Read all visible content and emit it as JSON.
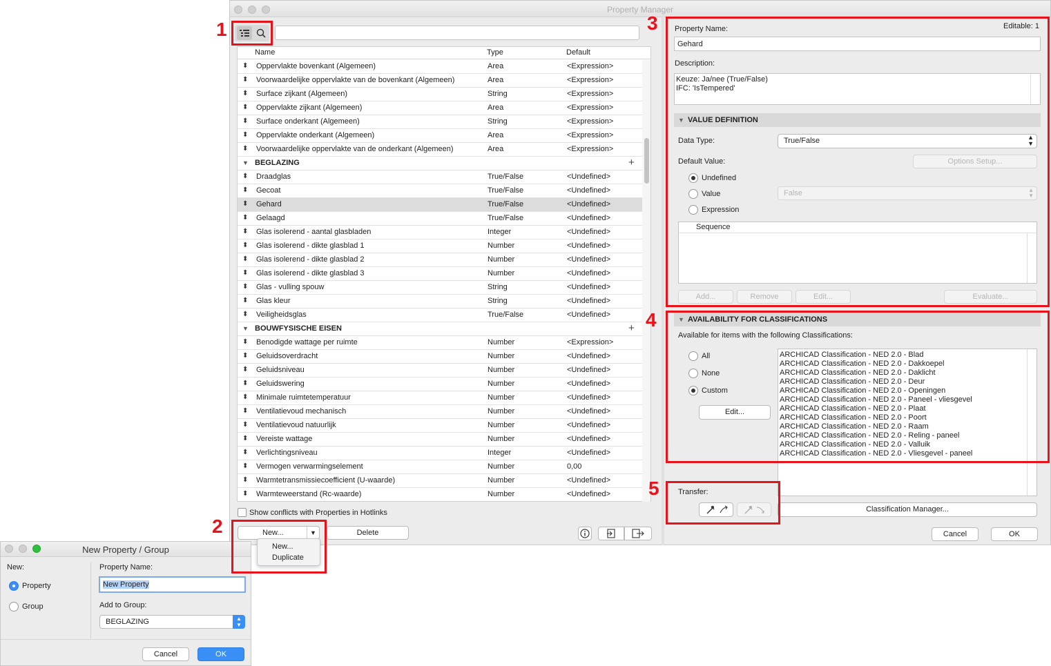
{
  "window": {
    "title": "Property Manager"
  },
  "toolbar": {
    "list_icon": "list-view-icon",
    "search_icon": "search-icon",
    "search_value": ""
  },
  "list": {
    "col_name": "Name",
    "col_type": "Type",
    "col_default": "Default",
    "rows": [
      {
        "kind": "item",
        "name": "Oppervlakte bovenkant (Algemeen)",
        "type": "Area",
        "def": "<Expression>"
      },
      {
        "kind": "item",
        "name": "Voorwaardelijke oppervlakte van de bovenkant (Algemeen)",
        "type": "Area",
        "def": "<Expression>"
      },
      {
        "kind": "item",
        "name": "Surface zijkant (Algemeen)",
        "type": "String",
        "def": "<Expression>"
      },
      {
        "kind": "item",
        "name": "Oppervlakte zijkant (Algemeen)",
        "type": "Area",
        "def": "<Expression>"
      },
      {
        "kind": "item",
        "name": "Surface onderkant (Algemeen)",
        "type": "String",
        "def": "<Expression>"
      },
      {
        "kind": "item",
        "name": "Oppervlakte onderkant (Algemeen)",
        "type": "Area",
        "def": "<Expression>"
      },
      {
        "kind": "item",
        "name": "Voorwaardelijke oppervlakte van de onderkant (Algemeen)",
        "type": "Area",
        "def": "<Expression>"
      },
      {
        "kind": "group",
        "name": "BEGLAZING"
      },
      {
        "kind": "item",
        "name": "Draadglas",
        "type": "True/False",
        "def": "<Undefined>"
      },
      {
        "kind": "item",
        "name": "Gecoat",
        "type": "True/False",
        "def": "<Undefined>"
      },
      {
        "kind": "item",
        "name": "Gehard",
        "type": "True/False",
        "def": "<Undefined>",
        "selected": true
      },
      {
        "kind": "item",
        "name": "Gelaagd",
        "type": "True/False",
        "def": "<Undefined>"
      },
      {
        "kind": "item",
        "name": "Glas isolerend - aantal glasbladen",
        "type": "Integer",
        "def": "<Undefined>"
      },
      {
        "kind": "item",
        "name": "Glas isolerend - dikte glasblad 1",
        "type": "Number",
        "def": "<Undefined>"
      },
      {
        "kind": "item",
        "name": "Glas isolerend - dikte glasblad 2",
        "type": "Number",
        "def": "<Undefined>"
      },
      {
        "kind": "item",
        "name": "Glas isolerend - dikte glasblad 3",
        "type": "Number",
        "def": "<Undefined>"
      },
      {
        "kind": "item",
        "name": "Glas  - vulling spouw",
        "type": "String",
        "def": "<Undefined>"
      },
      {
        "kind": "item",
        "name": "Glas kleur",
        "type": "String",
        "def": "<Undefined>"
      },
      {
        "kind": "item",
        "name": "Veiligheidsglas",
        "type": "True/False",
        "def": "<Undefined>"
      },
      {
        "kind": "group",
        "name": "BOUWFYSISCHE EISEN"
      },
      {
        "kind": "item",
        "name": "Benodigde wattage per ruimte",
        "type": "Number",
        "def": "<Expression>"
      },
      {
        "kind": "item",
        "name": "Geluidsoverdracht",
        "type": "Number",
        "def": "<Undefined>"
      },
      {
        "kind": "item",
        "name": "Geluidsniveau",
        "type": "Number",
        "def": "<Undefined>"
      },
      {
        "kind": "item",
        "name": "Geluidswering",
        "type": "Number",
        "def": "<Undefined>"
      },
      {
        "kind": "item",
        "name": "Minimale ruimtetemperatuur",
        "type": "Number",
        "def": "<Undefined>"
      },
      {
        "kind": "item",
        "name": "Ventilatievoud mechanisch",
        "type": "Number",
        "def": "<Undefined>"
      },
      {
        "kind": "item",
        "name": "Ventilatievoud natuurlijk",
        "type": "Number",
        "def": "<Undefined>"
      },
      {
        "kind": "item",
        "name": "Vereiste wattage",
        "type": "Number",
        "def": "<Undefined>"
      },
      {
        "kind": "item",
        "name": "Verlichtingsniveau",
        "type": "Integer",
        "def": "<Undefined>"
      },
      {
        "kind": "item",
        "name": "Vermogen verwarmingselement",
        "type": "Number",
        "def": "0,00"
      },
      {
        "kind": "item",
        "name": "Warmtetransmissiecoefficient (U-waarde)",
        "type": "Number",
        "def": "<Undefined>"
      },
      {
        "kind": "item",
        "name": "Warmteweerstand (Rc-waarde)",
        "type": "Number",
        "def": "<Undefined>"
      }
    ]
  },
  "bottom": {
    "show_conflicts": "Show conflicts with Properties in Hotlinks",
    "new_label": "New...",
    "delete_label": "Delete",
    "menu": [
      "New...",
      "Duplicate"
    ]
  },
  "annotations": [
    "1",
    "2",
    "3",
    "4",
    "5"
  ],
  "details": {
    "property_name_label": "Property Name:",
    "editable": "Editable: 1",
    "property_name": "Gehard",
    "description_label": "Description:",
    "description_line1": "Keuze: Ja/nee (True/False)",
    "description_line2": "IFC: 'IsTempered'",
    "value_definition": "VALUE DEFINITION",
    "data_type_label": "Data Type:",
    "data_type": "True/False",
    "default_value_label": "Default Value:",
    "options_setup": "Options Setup...",
    "radio_undefined": "Undefined",
    "radio_value": "Value",
    "value_select": "False",
    "radio_expression": "Expression",
    "sequence_header": "Sequence",
    "add": "Add...",
    "remove": "Remove",
    "edit": "Edit...",
    "evaluate": "Evaluate..."
  },
  "availability": {
    "header": "AVAILABILITY FOR CLASSIFICATIONS",
    "subtitle": "Available for items with the following Classifications:",
    "radio_all": "All",
    "radio_none": "None",
    "radio_custom": "Custom",
    "edit": "Edit...",
    "classifications": [
      "ARCHICAD Classification - NED 2.0 - Blad",
      "ARCHICAD Classification - NED 2.0 - Dakkoepel",
      "ARCHICAD Classification - NED 2.0 - Daklicht",
      "ARCHICAD Classification - NED 2.0 - Deur",
      "ARCHICAD Classification - NED 2.0 - Openingen",
      "ARCHICAD Classification - NED 2.0 - Paneel - vliesgevel",
      "ARCHICAD Classification - NED 2.0 - Plaat",
      "ARCHICAD Classification - NED 2.0 - Poort",
      "ARCHICAD Classification - NED 2.0 - Raam",
      "ARCHICAD Classification - NED 2.0 - Reling - paneel",
      "ARCHICAD Classification - NED 2.0 - Valluik",
      "ARCHICAD Classification - NED 2.0 - Vliesgevel - paneel"
    ],
    "transfer_label": "Transfer:",
    "classification_manager": "Classification Manager...",
    "cancel": "Cancel",
    "ok": "OK"
  },
  "dialog": {
    "title": "New Property / Group",
    "new_label": "New:",
    "radio_property": "Property",
    "radio_group": "Group",
    "property_name_label": "Property Name:",
    "property_name_value": "New Property",
    "add_to_group_label": "Add to Group:",
    "group_value": "BEGLAZING",
    "cancel": "Cancel",
    "ok": "OK"
  },
  "colors": {
    "annotation_red": "#e8121b",
    "accent_blue": "#3a8ff7"
  }
}
